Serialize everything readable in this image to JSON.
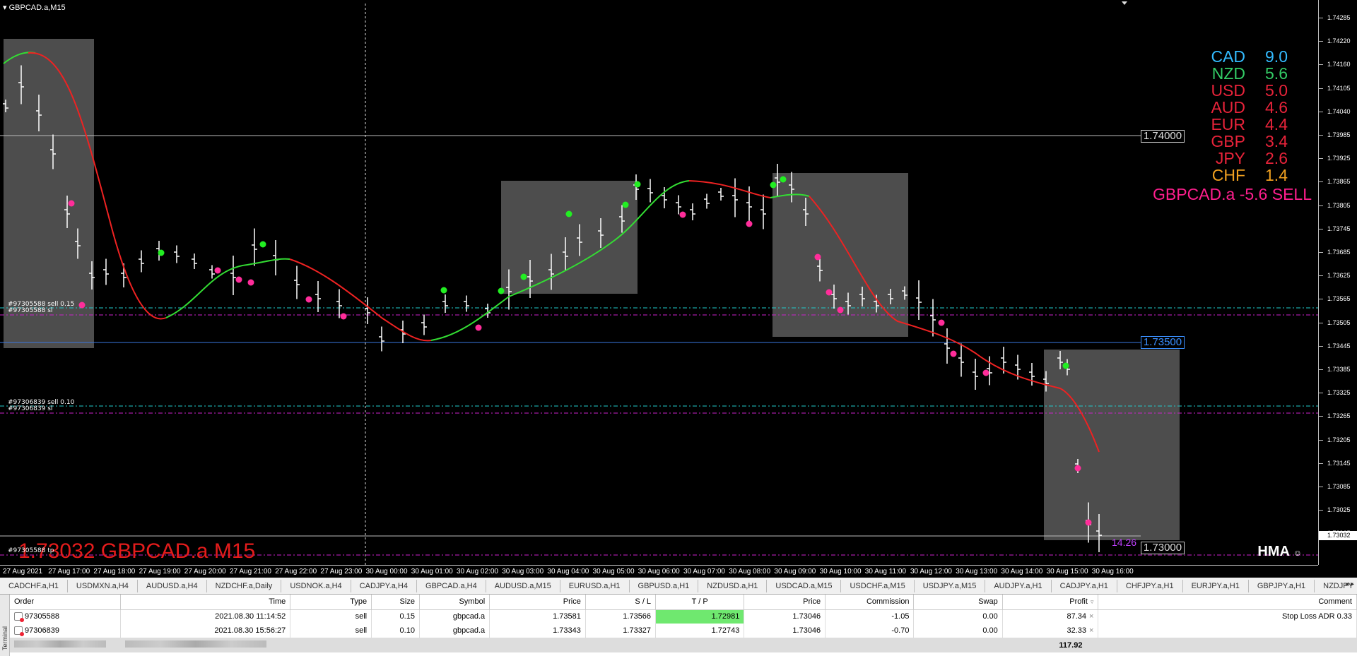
{
  "chart": {
    "symbol_label": "GBPCAD.a,M15",
    "y_ticks": [
      "1.74285",
      "1.74220",
      "1.74160",
      "1.74105",
      "1.74040",
      "1.73985",
      "1.73925",
      "1.73865",
      "1.73805",
      "1.73745",
      "1.73685",
      "1.73625",
      "1.73565",
      "1.73505",
      "1.73445",
      "1.73385",
      "1.73325",
      "1.73265",
      "1.73205",
      "1.73145",
      "1.73085",
      "1.73025",
      "1.72965"
    ],
    "current_price_tag": "1.73032",
    "x_ticks": [
      "27 Aug 2021",
      "27 Aug 17:00",
      "27 Aug 18:00",
      "27 Aug 19:00",
      "27 Aug 20:00",
      "27 Aug 21:00",
      "27 Aug 22:00",
      "27 Aug 23:00",
      "30 Aug 00:00",
      "30 Aug 01:00",
      "30 Aug 02:00",
      "30 Aug 03:00",
      "30 Aug 04:00",
      "30 Aug 05:00",
      "30 Aug 06:00",
      "30 Aug 07:00",
      "30 Aug 08:00",
      "30 Aug 09:00",
      "30 Aug 10:00",
      "30 Aug 11:00",
      "30 Aug 12:00",
      "30 Aug 13:00",
      "30 Aug 14:00",
      "30 Aug 15:00",
      "30 Aug 16:00"
    ],
    "level_labels": {
      "l1": "1.74000",
      "l2": "1.73500",
      "l3": "1.73000"
    },
    "order_labels": {
      "o1a": "#97305588 sell 0.15",
      "o1b": "#97305588 sl",
      "o2a": "#97306839 sell 0.10",
      "o2b": "#97306839 sl",
      "o3": "#97305588 tp"
    },
    "strength": [
      {
        "cur": "CAD",
        "val": "9.0",
        "color": "#33bbff"
      },
      {
        "cur": "NZD",
        "val": "5.6",
        "color": "#33cc66"
      },
      {
        "cur": "USD",
        "val": "5.0",
        "color": "#e8233a"
      },
      {
        "cur": "AUD",
        "val": "4.6",
        "color": "#e8233a"
      },
      {
        "cur": "EUR",
        "val": "4.4",
        "color": "#e8233a"
      },
      {
        "cur": "GBP",
        "val": "3.4",
        "color": "#e8233a"
      },
      {
        "cur": "JPY",
        "val": "2.6",
        "color": "#e8233a"
      },
      {
        "cur": "CHF",
        "val": "1.4",
        "color": "#f0a020"
      }
    ],
    "signal_text": "GBPCAD.a -5.6 SELL",
    "big_price": "1.73032 GBPCAD.a M15",
    "indicator_name": "HMA",
    "pips_label": "14.26"
  },
  "tabs": [
    "CADCHF.a,H1",
    "USDMXN.a,H4",
    "AUDUSD.a,H4",
    "NZDCHF.a,Daily",
    "USDNOK.a,H4",
    "CADJPY.a,H4",
    "GBPCAD.a,H4",
    "AUDUSD.a,M15",
    "EURUSD.a,H1",
    "GBPUSD.a,H1",
    "NZDUSD.a,H1",
    "USDCAD.a,M15",
    "USDCHF.a,M15",
    "USDJPY.a,M15",
    "AUDJPY.a,H1",
    "CADJPY.a,H1",
    "CHFJPY.a,H1",
    "EURJPY.a,H1",
    "GBPJPY.a,H1",
    "NZDJPY"
  ],
  "tab_arrows": "◂ ▸",
  "trade": {
    "side_label": "Terminal",
    "headers": [
      "Order",
      "Time",
      "Type",
      "Size",
      "Symbol",
      "Price",
      "S / L",
      "T / P",
      "Price",
      "Commission",
      "Swap",
      "Profit",
      "Comment"
    ],
    "rows": [
      {
        "order": "97305588",
        "time": "2021.08.30 11:14:52",
        "type": "sell",
        "size": "0.15",
        "symbol": "gbpcad.a",
        "price": "1.73581",
        "sl": "1.73566",
        "tp": "1.72981",
        "cprice": "1.73046",
        "commission": "-1.05",
        "swap": "0.00",
        "profit": "87.34",
        "comment": "Stop Loss ADR 0.33"
      },
      {
        "order": "97306839",
        "time": "2021.08.30 15:56:27",
        "type": "sell",
        "size": "0.10",
        "symbol": "gbpcad.a",
        "price": "1.73343",
        "sl": "1.73327",
        "tp": "1.72743",
        "cprice": "1.73046",
        "commission": "-0.70",
        "swap": "0.00",
        "profit": "32.33",
        "comment": ""
      }
    ],
    "total_profit": "117.92"
  }
}
